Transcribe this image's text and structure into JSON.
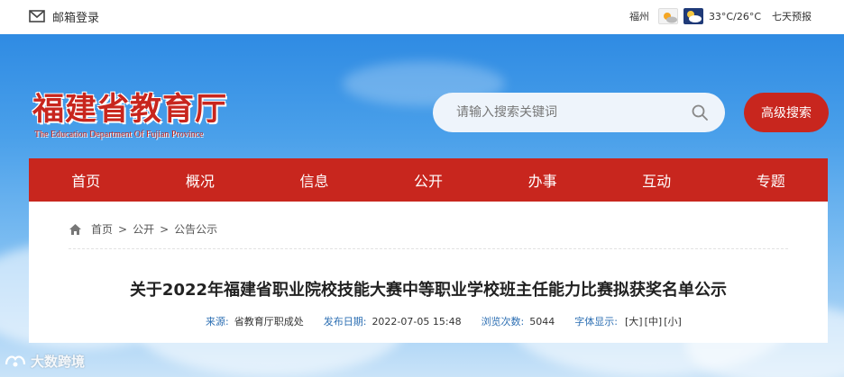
{
  "topbar": {
    "mail_label": "邮箱登录",
    "city": "福州",
    "temperature": "33°C/26°C",
    "forecast_label": "七天预报"
  },
  "header": {
    "logo_cn": "福建省教育厅",
    "logo_en": "The Education Department Of Fujian Province",
    "search_placeholder": "请输入搜索关键词",
    "advanced_search_label": "高级搜索"
  },
  "nav": {
    "items": [
      "首页",
      "概况",
      "信息",
      "公开",
      "办事",
      "互动",
      "专题"
    ]
  },
  "breadcrumb": {
    "items": [
      "首页",
      "公开",
      "公告公示"
    ],
    "separator": ">"
  },
  "article": {
    "title": "关于2022年福建省职业院校技能大赛中等职业学校班主任能力比赛拟获奖名单公示",
    "source_label": "来源:",
    "source_value": "省教育厅职成处",
    "date_label": "发布日期:",
    "date_value": "2022-07-05 15:48",
    "views_label": "浏览次数:",
    "views_value": "5044",
    "font_label": "字体显示:",
    "font_options": [
      "[大]",
      "[中]",
      "[小]"
    ]
  },
  "watermark": {
    "text": "大数跨境"
  },
  "colors": {
    "brand_red": "#c8261e",
    "sky_blue": "#4aa0ea",
    "meta_blue": "#2d6fb3"
  }
}
